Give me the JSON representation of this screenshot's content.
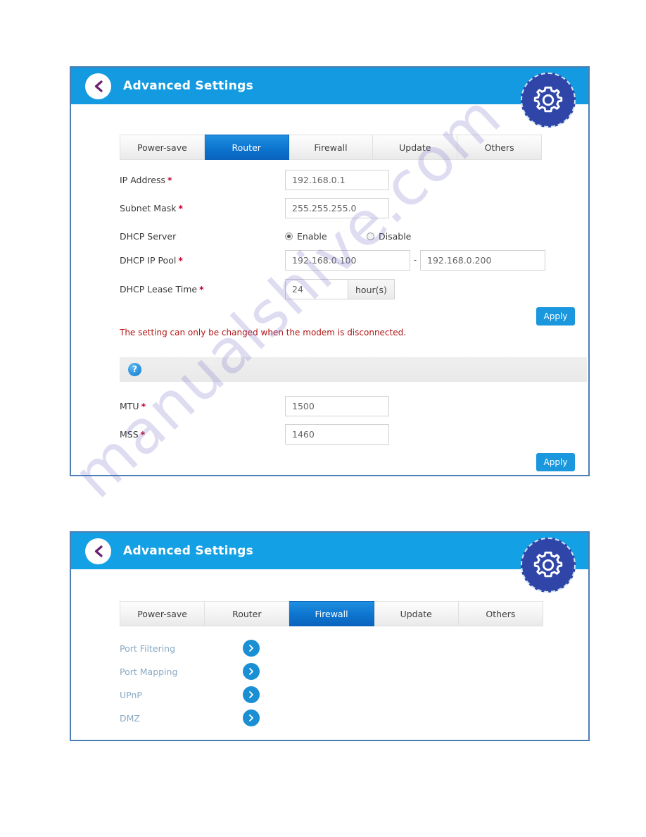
{
  "watermark": {
    "text": "manualshive.com"
  },
  "panels": [
    {
      "id": "router",
      "header": {
        "title": "Advanced Settings",
        "back_icon": "chevron-left-icon",
        "gear_icon": "gear-icon"
      },
      "tabs": [
        {
          "label": "Power-save",
          "active": false
        },
        {
          "label": "Router",
          "active": true
        },
        {
          "label": "Firewall",
          "active": false
        },
        {
          "label": "Update",
          "active": false
        },
        {
          "label": "Others",
          "active": false
        }
      ],
      "fields": {
        "ip_address": {
          "label": "IP Address",
          "required": "*",
          "value": "192.168.0.1"
        },
        "subnet_mask": {
          "label": "Subnet Mask",
          "required": "*",
          "value": "255.255.255.0"
        },
        "dhcp_server": {
          "label": "DHCP Server",
          "enable_label": "Enable",
          "disable_label": "Disable",
          "selected": "Enable"
        },
        "dhcp_ip_pool": {
          "label": "DHCP IP Pool",
          "required": "*",
          "start": "192.168.0.100",
          "separator": "-",
          "end": "192.168.0.200"
        },
        "dhcp_lease_time": {
          "label": "DHCP Lease Time",
          "required": "*",
          "value": "24",
          "unit": "hour(s)"
        },
        "mtu": {
          "label": "MTU",
          "required": "*",
          "value": "1500"
        },
        "mss": {
          "label": "MSS",
          "required": "*",
          "value": "1460"
        }
      },
      "notice": "The setting can only be changed when the modem is disconnected.",
      "help_bar": {
        "icon": "question-mark-icon",
        "icon_label": "?"
      },
      "apply_top_label": "Apply",
      "apply_bottom_label": "Apply"
    },
    {
      "id": "firewall",
      "header": {
        "title": "Advanced Settings",
        "back_icon": "chevron-left-icon",
        "gear_icon": "gear-icon"
      },
      "tabs": [
        {
          "label": "Power-save",
          "active": false
        },
        {
          "label": "Router",
          "active": false
        },
        {
          "label": "Firewall",
          "active": true
        },
        {
          "label": "Update",
          "active": false
        },
        {
          "label": "Others",
          "active": false
        }
      ],
      "menu": [
        {
          "label": "Port Filtering",
          "arrow_icon": "chevron-right-icon"
        },
        {
          "label": "Port Mapping",
          "arrow_icon": "chevron-right-icon"
        },
        {
          "label": "UPnP",
          "arrow_icon": "chevron-right-icon"
        },
        {
          "label": "DMZ",
          "arrow_icon": "chevron-right-icon"
        }
      ]
    }
  ],
  "colors": {
    "header_blue": "#139ae0",
    "accent_blue": "#1a97dd",
    "active_tab_blue": "#0d75cf",
    "gear_navy": "#2f45a8",
    "notice_red": "#b11616",
    "required_red": "#c2002f",
    "panel_border": "#4a7fb5",
    "fw_label": "#89a9c4"
  }
}
